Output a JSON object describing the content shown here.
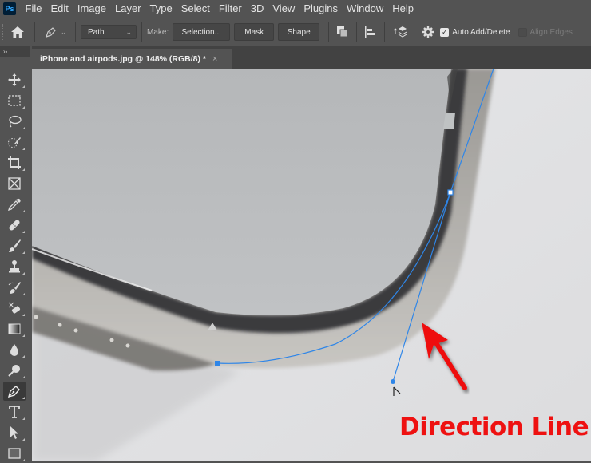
{
  "app": {
    "logo": "Ps"
  },
  "menu": [
    "File",
    "Edit",
    "Image",
    "Layer",
    "Type",
    "Select",
    "Filter",
    "3D",
    "View",
    "Plugins",
    "Window",
    "Help"
  ],
  "options": {
    "home_icon": "home-icon",
    "tool_icon": "pen-tool-icon",
    "mode_select": "Path",
    "make_label": "Make:",
    "selection_button": "Selection...",
    "mask_button": "Mask",
    "shape_button": "Shape",
    "path_operations_icon": "path-operations-icon",
    "path_alignment_icon": "path-alignment-icon",
    "path_arrangement_icon": "path-arrangement-icon",
    "settings_icon": "gear-icon",
    "auto_add_delete": {
      "label": "Auto Add/Delete",
      "checked": true
    },
    "align_edges": {
      "label": "Align Edges",
      "checked": false,
      "disabled": true
    }
  },
  "document_tab": {
    "title": "iPhone and airpods.jpg @ 148% (RGB/8) *",
    "close": "×"
  },
  "toolbar": {
    "collapse": "››",
    "tools": [
      {
        "name": "move-tool"
      },
      {
        "name": "rectangular-marquee-tool"
      },
      {
        "name": "lasso-tool"
      },
      {
        "name": "quick-selection-tool"
      },
      {
        "name": "crop-tool"
      },
      {
        "name": "frame-tool"
      },
      {
        "name": "eyedropper-tool"
      },
      {
        "name": "spot-healing-brush-tool"
      },
      {
        "name": "brush-tool"
      },
      {
        "name": "clone-stamp-tool"
      },
      {
        "name": "history-brush-tool"
      },
      {
        "name": "eraser-tool"
      },
      {
        "name": "gradient-tool"
      },
      {
        "name": "blur-tool"
      },
      {
        "name": "dodge-tool"
      },
      {
        "name": "pen-tool",
        "active": true
      },
      {
        "name": "type-tool"
      },
      {
        "name": "path-selection-tool"
      },
      {
        "name": "rectangle-tool"
      }
    ]
  },
  "canvas": {
    "annotation_text": "Direction Line",
    "annotation_color": "#ee1111",
    "path_color": "#2f86e8"
  }
}
